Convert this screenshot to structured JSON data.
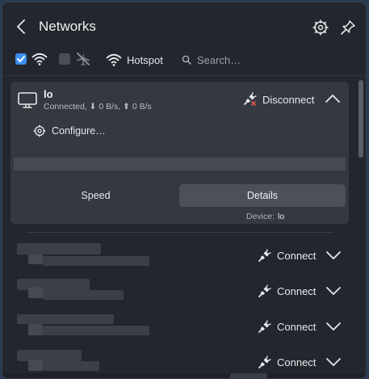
{
  "header": {
    "title": "Networks"
  },
  "toolbar": {
    "wifi_enabled": true,
    "airplane_enabled": false,
    "hotspot_label": "Hotspot",
    "search_placeholder": "Search…"
  },
  "active_connection": {
    "name": "lo",
    "status": "Connected, ⬇ 0 B/s, ⬆ 0 B/s",
    "disconnect_label": "Disconnect",
    "configure_label": "Configure…",
    "tabs": [
      {
        "label": "Speed",
        "active": false
      },
      {
        "label": "Details",
        "active": true
      }
    ],
    "device_label": "Device:",
    "device_value": "lo"
  },
  "networks": [
    {
      "connect_label": "Connect"
    },
    {
      "connect_label": "Connect"
    },
    {
      "connect_label": "Connect"
    },
    {
      "connect_label": "Connect"
    }
  ],
  "icons": {
    "back": "chevron-left-icon",
    "settings": "gear-icon",
    "pin": "pin-icon",
    "wifi": "wifi-icon",
    "airplane": "airplane-off-icon",
    "hotspot": "wifi-icon",
    "search": "search-icon",
    "device": "monitor-icon",
    "disconnect": "unplug-icon",
    "connect": "plug-icon",
    "collapse": "chevron-up-icon",
    "expand": "chevron-down-icon",
    "configure": "gear-icon"
  },
  "colors": {
    "accent": "#3d8ef0",
    "panel": "#23262d",
    "card": "#34383f"
  }
}
